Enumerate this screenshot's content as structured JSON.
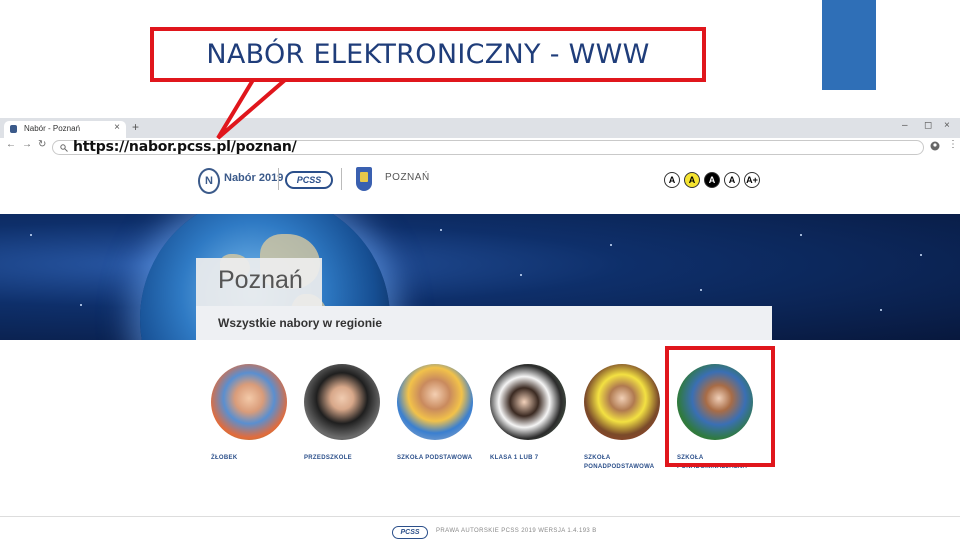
{
  "slide": {
    "callout_text": "NABÓR ELEKTRONICZNY - WWW"
  },
  "browser": {
    "tab_title": "Nabór - Poznań",
    "tab_close": "×",
    "new_tab": "+",
    "window_controls": [
      "–",
      "◻",
      "×"
    ],
    "nav_back": "←",
    "nav_forward": "→",
    "nav_reload": "↻",
    "search_icon": "search-icon",
    "url": "https://nabor.pcss.pl/poznan/",
    "profile_icon": "profile-icon",
    "menu_icon": "⋮"
  },
  "header": {
    "brand_letter": "N",
    "nabor_label": "Nabór 2019",
    "pcss_logo": "PCSS",
    "city": "POZNAŃ",
    "accessibility_buttons": [
      "A",
      "A",
      "A",
      "A",
      "A+"
    ]
  },
  "hero": {
    "city_title": "Poznań",
    "region_text": "Wszystkie nabory w regionie"
  },
  "categories": [
    {
      "label": "ŻŁOBEK",
      "label2": ""
    },
    {
      "label": "PRZEDSZKOLE",
      "label2": ""
    },
    {
      "label": "SZKOŁA PODSTAWOWA",
      "label2": ""
    },
    {
      "label": "KLASA 1 LUB 7",
      "label2": ""
    },
    {
      "label": "SZKOŁA",
      "label2": "PONADPODSTAWOWA"
    },
    {
      "label": "SZKOŁA",
      "label2": "PONADGIMNAZJALNA"
    }
  ],
  "footer": {
    "logo": "PCSS",
    "text": "PRAWA AUTORSKIE PCSS 2019 WERSJA 1.4.193 B"
  },
  "colors": {
    "callout_border": "#e0161c",
    "callout_text": "#1f3d7a",
    "brand_blue": "#2b4f8a",
    "slide_accent": "#2f6fb7"
  }
}
